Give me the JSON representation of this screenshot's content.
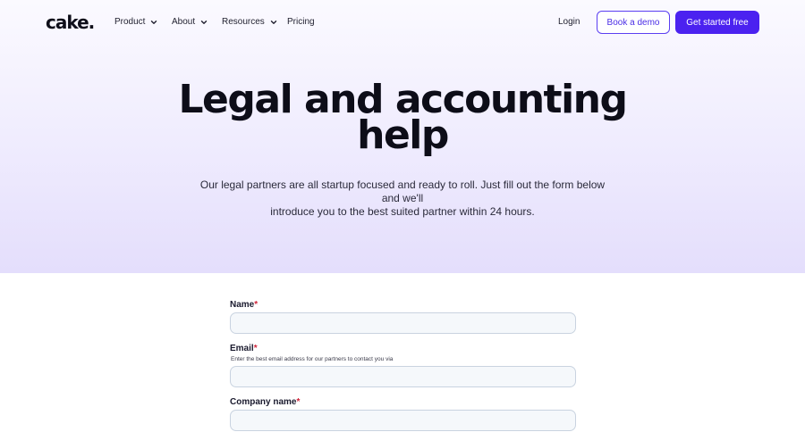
{
  "nav": {
    "logo": "cake.",
    "items": [
      {
        "label": "Product",
        "has_dropdown": true
      },
      {
        "label": "About",
        "has_dropdown": true
      },
      {
        "label": "Resources",
        "has_dropdown": true
      },
      {
        "label": "Pricing",
        "has_dropdown": false
      }
    ],
    "login": "Login",
    "demo_button": "Book a demo",
    "start_button": "Get started free"
  },
  "hero": {
    "title_line1": "Legal and accounting",
    "title_line2": "help",
    "subtitle_line1": "Our legal partners are all startup focused and ready to roll. Just fill out the form below and we'll",
    "subtitle_line2": "introduce you to the best suited partner within 24 hours."
  },
  "form": {
    "required_marker": "*",
    "name": {
      "label": "Name",
      "value": ""
    },
    "email": {
      "label": "Email",
      "hint": "Enter the best email address for our partners to contact you via",
      "value": ""
    },
    "company": {
      "label": "Company name",
      "value": ""
    }
  },
  "colors": {
    "accent": "#4b22f0",
    "hero_bg_top": "#fbfaff",
    "hero_bg_bottom": "#e4defc",
    "required": "#d0243a"
  }
}
